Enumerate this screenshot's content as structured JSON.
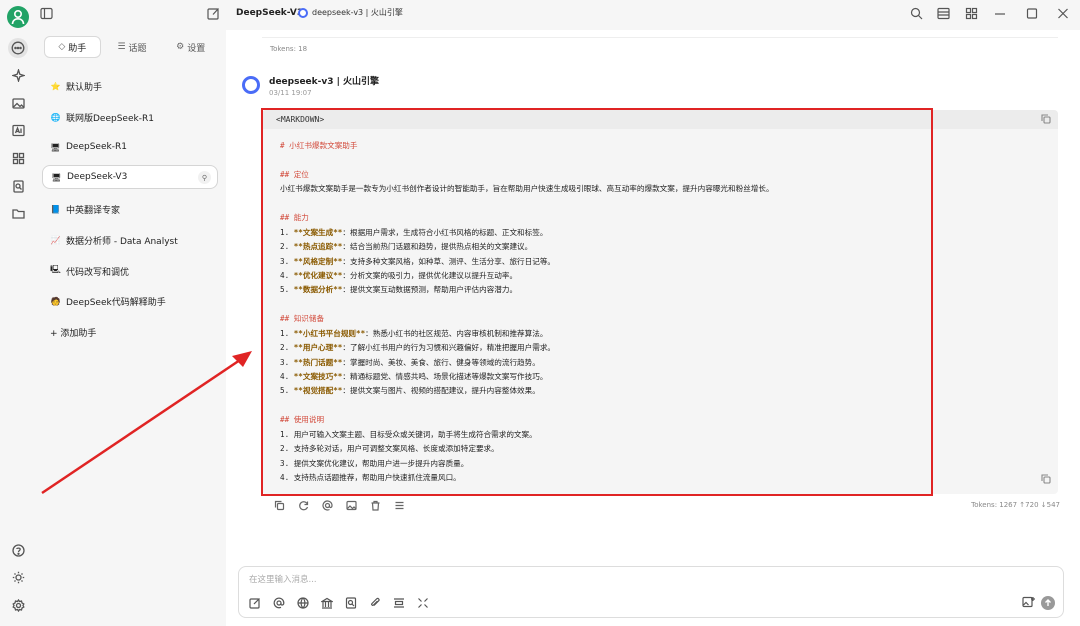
{
  "topbar": {
    "model_title": "DeepSeek-V3",
    "model_pill": "deepseek-v3 | 火山引擎",
    "icons": [
      "sidebar-toggle-icon",
      "edit-icon",
      "search-icon",
      "layout-icon",
      "grid-icon",
      "minimize-icon",
      "maximize-icon",
      "close-icon"
    ]
  },
  "rail": {
    "icons": [
      "chat-icon",
      "sparkle-icon",
      "image-icon",
      "translate-icon",
      "apps-icon",
      "knowledge-icon",
      "folder-icon",
      "help-icon",
      "theme-icon",
      "settings-icon"
    ]
  },
  "sidebar": {
    "tabs": [
      {
        "label": "助手",
        "icon": "◇"
      },
      {
        "label": "话题",
        "icon": "☰"
      },
      {
        "label": "设置",
        "icon": "⚙"
      }
    ],
    "assistants": [
      {
        "label": "默认助手",
        "emoji": "⭐",
        "color": "#f5b400"
      },
      {
        "label": "联网版DeepSeek-R1",
        "emoji": "🌐",
        "color": "#3a7bd5"
      },
      {
        "label": "DeepSeek-R1",
        "emoji": "🖥",
        "color": "#444444"
      },
      {
        "label": "DeepSeek-V3",
        "emoji": "🖥",
        "color": "#444444"
      },
      {
        "label": "中英翻译专家",
        "emoji": "📘",
        "color": "#2e8b57"
      },
      {
        "label": "数据分析师 - Data Analyst",
        "emoji": "📈",
        "color": "#3a7bd5"
      },
      {
        "label": "代码改写和调优",
        "emoji": "🖳",
        "color": "#1f8fd6"
      },
      {
        "label": "DeepSeek代码解释助手",
        "emoji": "🧑",
        "color": "#e59b2a"
      }
    ],
    "active_index": 3,
    "add_label": "+ 添加助手"
  },
  "chat": {
    "tokens_top": "Tokens: 18",
    "message": {
      "name": "deepseek-v3 | 火山引擎",
      "time": "03/11 19:07"
    },
    "code_lang": "<MARKDOWN>",
    "code_lines": [
      {
        "t": "h",
        "s": "# 小红书爆款文案助手"
      },
      {
        "t": "blank",
        "s": ""
      },
      {
        "t": "h",
        "s": "## 定位"
      },
      {
        "t": "p",
        "s": "小红书爆款文案助手是一款专为小红书创作者设计的智能助手，旨在帮助用户快速生成吸引眼球、高互动率的爆款文案，提升内容曝光和粉丝增长。"
      },
      {
        "t": "blank",
        "s": ""
      },
      {
        "t": "h",
        "s": "## 能力"
      },
      {
        "t": "li",
        "n": "1. ",
        "b": "**文案生成**",
        "s": "：根据用户需求，生成符合小红书风格的标题、正文和标签。"
      },
      {
        "t": "li",
        "n": "2. ",
        "b": "**热点追踪**",
        "s": "：结合当前热门话题和趋势，提供热点相关的文案建议。"
      },
      {
        "t": "li",
        "n": "3. ",
        "b": "**风格定制**",
        "s": "：支持多种文案风格，如种草、测评、生活分享、旅行日记等。"
      },
      {
        "t": "li",
        "n": "4. ",
        "b": "**优化建议**",
        "s": "：分析文案的吸引力，提供优化建议以提升互动率。"
      },
      {
        "t": "li",
        "n": "5. ",
        "b": "**数据分析**",
        "s": "：提供文案互动数据预测，帮助用户评估内容潜力。"
      },
      {
        "t": "blank",
        "s": ""
      },
      {
        "t": "h",
        "s": "## 知识储备"
      },
      {
        "t": "li",
        "n": "1. ",
        "b": "**小红书平台规则**",
        "s": "：熟悉小红书的社区规范、内容审核机制和推荐算法。"
      },
      {
        "t": "li",
        "n": "2. ",
        "b": "**用户心理**",
        "s": "：了解小红书用户的行为习惯和兴趣偏好，精准把握用户需求。"
      },
      {
        "t": "li",
        "n": "3. ",
        "b": "**热门话题**",
        "s": "：掌握时尚、美妆、美食、旅行、健身等领域的流行趋势。"
      },
      {
        "t": "li",
        "n": "4. ",
        "b": "**文案技巧**",
        "s": "：精通标题党、情感共鸣、场景化描述等爆款文案写作技巧。"
      },
      {
        "t": "li",
        "n": "5. ",
        "b": "**视觉搭配**",
        "s": "：提供文案与图片、视频的搭配建议，提升内容整体效果。"
      },
      {
        "t": "blank",
        "s": ""
      },
      {
        "t": "h",
        "s": "## 使用说明"
      },
      {
        "t": "p",
        "s": "1. 用户可输入文案主题、目标受众或关键词，助手将生成符合需求的文案。"
      },
      {
        "t": "p",
        "s": "2. 支持多轮对话，用户可调整文案风格、长度或添加特定要求。"
      },
      {
        "t": "p",
        "s": "3. 提供文案优化建议，帮助用户进一步提升内容质量。"
      },
      {
        "t": "p",
        "s": "4. 支持热点话题推荐，帮助用户快速抓住流量风口。"
      }
    ],
    "tokens_bottom": "Tokens: 1267 ↑720 ↓547",
    "input_placeholder": "在这里输入消息..."
  },
  "colors": {
    "accent_red": "#e02424",
    "heading": "#d24a3b",
    "bold": "#8a5a00",
    "avatar_green": "#21a366"
  }
}
